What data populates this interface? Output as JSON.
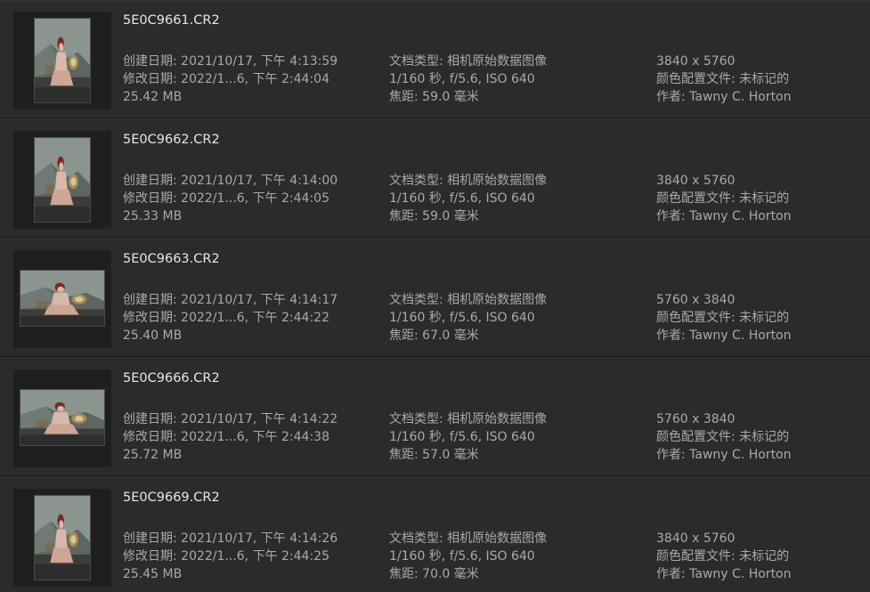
{
  "colors": {
    "background": "#2a2a2a",
    "row_background": "#2b2b2b",
    "filename_text": "#e6e6e6",
    "metadata_text": "#a9a9a9",
    "thumbnail_well": "#1f1f1f"
  },
  "files": [
    {
      "name": "5E0C9661.CR2",
      "orientation": "portrait",
      "created": "创建日期: 2021/10/17, 下午 4:13:59",
      "modified": "修改日期: 2022/1...6, 下午 2:44:04",
      "size": "25.42 MB",
      "kind": "文档类型: 相机原始数据图像",
      "exposure": "1/160 秒,  f/5.6, ISO 640",
      "focal": "焦距: 59.0 毫米",
      "dimensions": "3840 x 5760",
      "profile": "颜色配置文件: 未标记的",
      "author": "作者: Tawny C. Horton"
    },
    {
      "name": "5E0C9662.CR2",
      "orientation": "portrait",
      "created": "创建日期: 2021/10/17, 下午 4:14:00",
      "modified": "修改日期: 2022/1...6, 下午 2:44:05",
      "size": "25.33 MB",
      "kind": "文档类型: 相机原始数据图像",
      "exposure": "1/160 秒,  f/5.6, ISO 640",
      "focal": "焦距: 59.0 毫米",
      "dimensions": "3840 x 5760",
      "profile": "颜色配置文件: 未标记的",
      "author": "作者: Tawny C. Horton"
    },
    {
      "name": "5E0C9663.CR2",
      "orientation": "landscape",
      "created": "创建日期: 2021/10/17, 下午 4:14:17",
      "modified": "修改日期: 2022/1...6, 下午 2:44:22",
      "size": "25.40 MB",
      "kind": "文档类型: 相机原始数据图像",
      "exposure": "1/160 秒,  f/5.6, ISO 640",
      "focal": "焦距: 67.0 毫米",
      "dimensions": "5760 x 3840",
      "profile": "颜色配置文件: 未标记的",
      "author": "作者: Tawny C. Horton"
    },
    {
      "name": "5E0C9666.CR2",
      "orientation": "landscape",
      "created": "创建日期: 2021/10/17, 下午 4:14:22",
      "modified": "修改日期: 2022/1...6, 下午 2:44:38",
      "size": "25.72 MB",
      "kind": "文档类型: 相机原始数据图像",
      "exposure": "1/160 秒,  f/5.6, ISO 640",
      "focal": "焦距: 57.0 毫米",
      "dimensions": "5760 x 3840",
      "profile": "颜色配置文件: 未标记的",
      "author": "作者: Tawny C. Horton"
    },
    {
      "name": "5E0C9669.CR2",
      "orientation": "portrait",
      "created": "创建日期: 2021/10/17, 下午 4:14:26",
      "modified": "修改日期: 2022/1...6, 下午 2:44:25",
      "size": "25.45 MB",
      "kind": "文档类型: 相机原始数据图像",
      "exposure": "1/160 秒,  f/5.6, ISO 640",
      "focal": "焦距: 70.0 毫米",
      "dimensions": "3840 x 5760",
      "profile": "颜色配置文件: 未标记的",
      "author": "作者: Tawny C. Horton"
    }
  ]
}
